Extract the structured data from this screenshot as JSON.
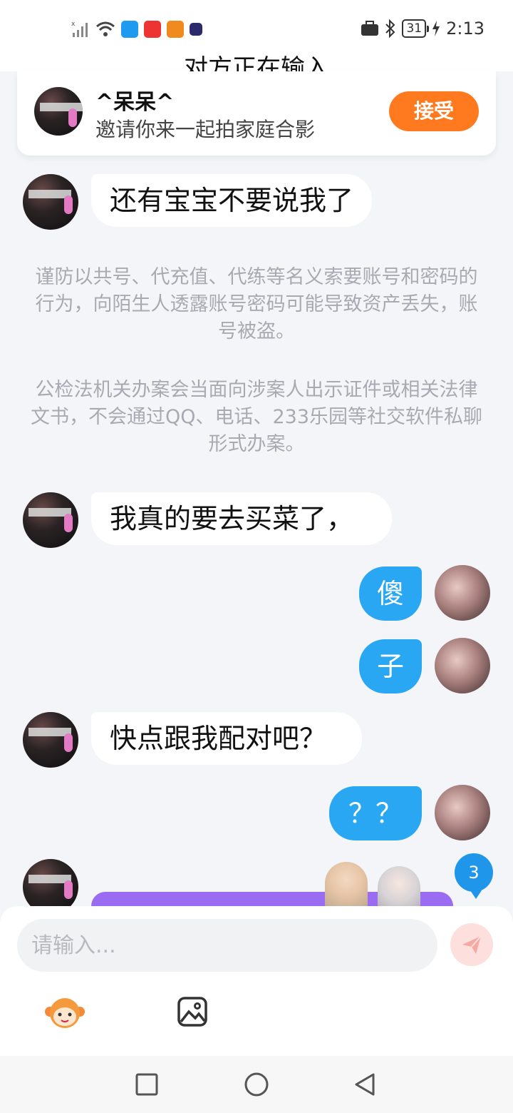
{
  "status_bar": {
    "battery": "31",
    "time": "2:13"
  },
  "header": {
    "title": "对方正在输入"
  },
  "invite": {
    "name": "^呆呆^",
    "text": "邀请你来一起拍家庭合影",
    "accept_label": "接受"
  },
  "messages": [
    {
      "side": "left",
      "text": "还有宝宝不要说我了"
    },
    {
      "side": "left",
      "text": "我真的要去买菜了，"
    },
    {
      "side": "right",
      "text": "傻"
    },
    {
      "side": "right",
      "text": "子"
    },
    {
      "side": "left",
      "text": "快点跟我配对吧？"
    },
    {
      "side": "right",
      "text": "？？"
    }
  ],
  "notices": [
    "谨防以共号、代充值、代练等名义索要账号和密码的行为，向陌生人透露账号密码可能导致资产丢失，账号被盗。",
    "公检法机关办案会当面向涉案人出示证件或相关法律文书，不会通过QQ、电话、233乐园等社交软件私聊形式办案。"
  ],
  "unread_count": "3",
  "input": {
    "placeholder": "请输入..."
  },
  "icons": {
    "send": "send-icon",
    "emoji": "monkey-emoji-icon",
    "image": "image-icon",
    "nav": [
      "square-icon",
      "circle-icon",
      "triangle-back-icon"
    ]
  },
  "colors": {
    "accent_blue": "#2aa7f2",
    "accept_orange": "#ff7a1f",
    "purple_card": "#9a6cf2"
  }
}
